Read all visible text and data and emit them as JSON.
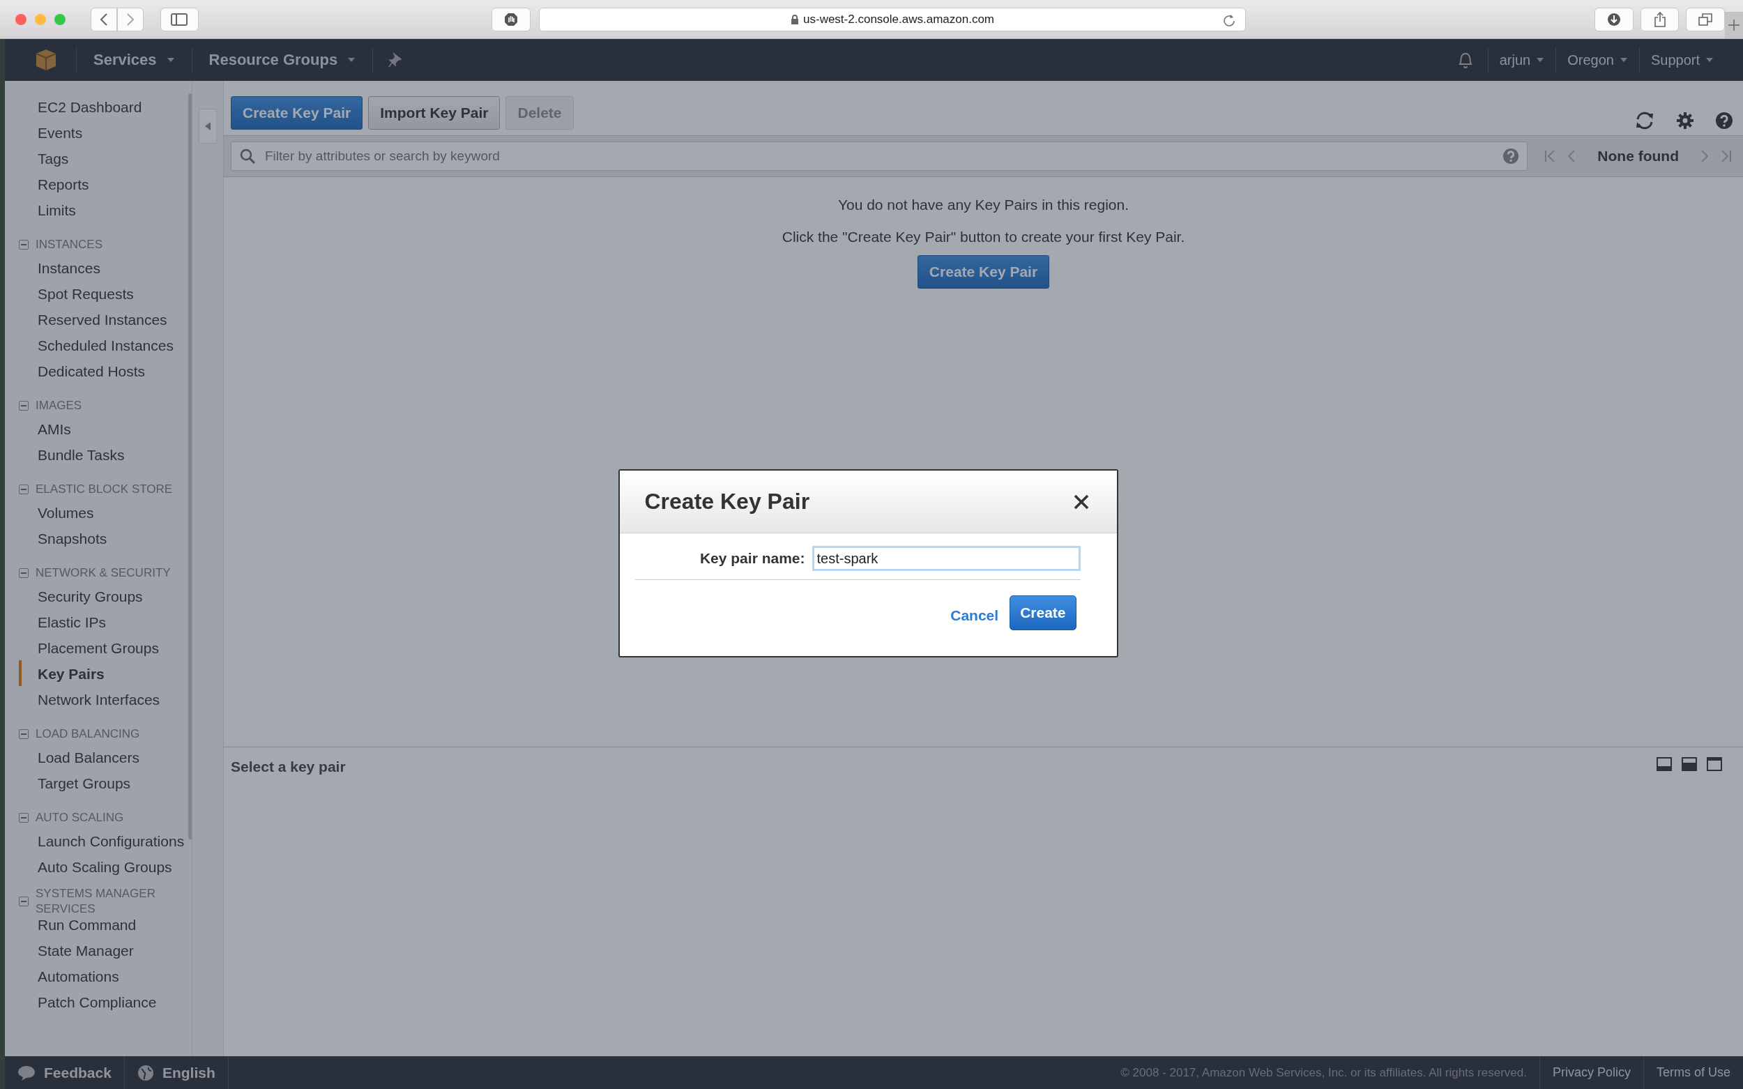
{
  "browser": {
    "url": "us-west-2.console.aws.amazon.com"
  },
  "nav": {
    "left": [
      {
        "label": "Services",
        "kind": "menu"
      },
      {
        "label": "Resource Groups",
        "kind": "menu"
      }
    ],
    "right": [
      {
        "label": "arjun"
      },
      {
        "label": "Oregon"
      },
      {
        "label": "Support"
      }
    ]
  },
  "sidebar": {
    "groups": [
      {
        "items": [
          {
            "label": "EC2 Dashboard",
            "selected": false
          },
          {
            "label": "Events",
            "selected": false
          },
          {
            "label": "Tags",
            "selected": false
          },
          {
            "label": "Reports",
            "selected": false
          },
          {
            "label": "Limits",
            "selected": false
          }
        ]
      },
      {
        "title": "INSTANCES",
        "expanded": true,
        "items": [
          {
            "label": "Instances",
            "selected": false
          },
          {
            "label": "Spot Requests",
            "selected": false
          },
          {
            "label": "Reserved Instances",
            "selected": false
          },
          {
            "label": "Scheduled Instances",
            "selected": false
          },
          {
            "label": "Dedicated Hosts",
            "selected": false
          }
        ]
      },
      {
        "title": "IMAGES",
        "expanded": true,
        "items": [
          {
            "label": "AMIs",
            "selected": false
          },
          {
            "label": "Bundle Tasks",
            "selected": false
          }
        ]
      },
      {
        "title": "ELASTIC BLOCK STORE",
        "expanded": true,
        "items": [
          {
            "label": "Volumes",
            "selected": false
          },
          {
            "label": "Snapshots",
            "selected": false
          }
        ]
      },
      {
        "title": "NETWORK & SECURITY",
        "expanded": true,
        "items": [
          {
            "label": "Security Groups",
            "selected": false
          },
          {
            "label": "Elastic IPs",
            "selected": false
          },
          {
            "label": "Placement Groups",
            "selected": false
          },
          {
            "label": "Key Pairs",
            "selected": true
          },
          {
            "label": "Network Interfaces",
            "selected": false
          }
        ]
      },
      {
        "title": "LOAD BALANCING",
        "expanded": true,
        "items": [
          {
            "label": "Load Balancers",
            "selected": false
          },
          {
            "label": "Target Groups",
            "selected": false
          }
        ]
      },
      {
        "title": "AUTO SCALING",
        "expanded": true,
        "items": [
          {
            "label": "Launch Configurations",
            "selected": false
          },
          {
            "label": "Auto Scaling Groups",
            "selected": false
          }
        ]
      },
      {
        "title": "SYSTEMS MANAGER SERVICES",
        "expanded": true,
        "items": [
          {
            "label": "Run Command",
            "selected": false
          },
          {
            "label": "State Manager",
            "selected": false
          },
          {
            "label": "Automations",
            "selected": false
          },
          {
            "label": "Patch Compliance",
            "selected": false
          }
        ]
      }
    ]
  },
  "toolbar": {
    "buttons": [
      {
        "label": "Create Key Pair",
        "kind": "primary",
        "disabled": false
      },
      {
        "label": "Import Key Pair",
        "kind": "secondary",
        "disabled": false
      },
      {
        "label": "Delete",
        "kind": "secondary",
        "disabled": true
      }
    ]
  },
  "filter": {
    "placeholder": "Filter by attributes or search by keyword",
    "pagination": "None found"
  },
  "empty_state": {
    "message": "You do not have any Key Pairs in this region.",
    "hint": "Click the \"Create Key Pair\" button to create your first Key Pair.",
    "button": "Create Key Pair"
  },
  "details": {
    "title": "Select a key pair"
  },
  "modal": {
    "title": "Create Key Pair",
    "field_label": "Key pair name:",
    "field_value": "test-spark",
    "cancel": "Cancel",
    "submit": "Create"
  },
  "footer": {
    "feedback": "Feedback",
    "language": "English",
    "copyright": "© 2008 - 2017, Amazon Web Services, Inc. or its affiliates. All rights reserved.",
    "links": [
      "Privacy Policy",
      "Terms of Use"
    ]
  }
}
